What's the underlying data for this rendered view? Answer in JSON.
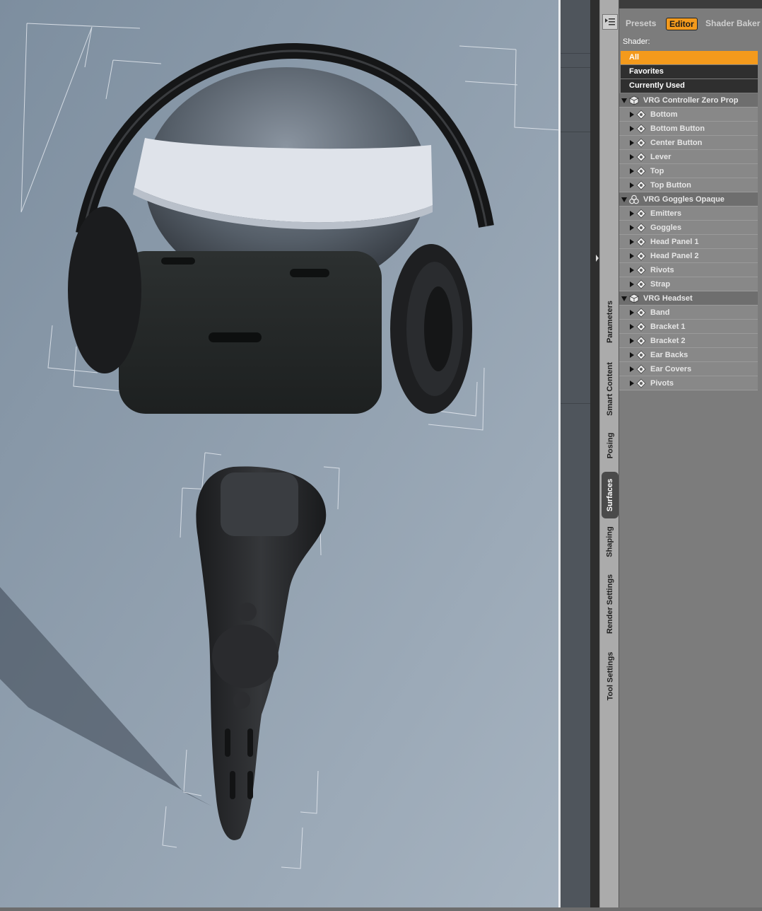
{
  "panel": {
    "tabs": {
      "presets": "Presets",
      "editor": "Editor",
      "shader_baker": "Shader Baker"
    },
    "shader_label": "Shader:",
    "filters": [
      "All",
      "Favorites",
      "Currently Used"
    ],
    "tree": [
      {
        "label": "VRG Controller Zero Prop",
        "children": [
          "Bottom",
          "Bottom Button",
          "Center Button",
          "Lever",
          "Top",
          "Top Button"
        ]
      },
      {
        "label": "VRG Goggles Opaque",
        "children": [
          "Emitters",
          "Goggles",
          "Head Panel 1",
          "Head Panel 2",
          "Rivots",
          "Strap"
        ]
      },
      {
        "label": "VRG Headset",
        "children": [
          "Band",
          "Bracket 1",
          "Bracket 2",
          "Ear Backs",
          "Ear Covers",
          "Pivots"
        ]
      }
    ]
  },
  "side_tabs": [
    "Parameters",
    "Smart Content",
    "Posing",
    "Surfaces",
    "Shaping",
    "Render Settings",
    "Tool Settings"
  ],
  "active_side_tab": "Surfaces",
  "active_panel_tab": "Editor",
  "selected_filter": "All",
  "colors": {
    "accent": "#f49a1c",
    "viewport_bg": "#7e8fa0"
  }
}
